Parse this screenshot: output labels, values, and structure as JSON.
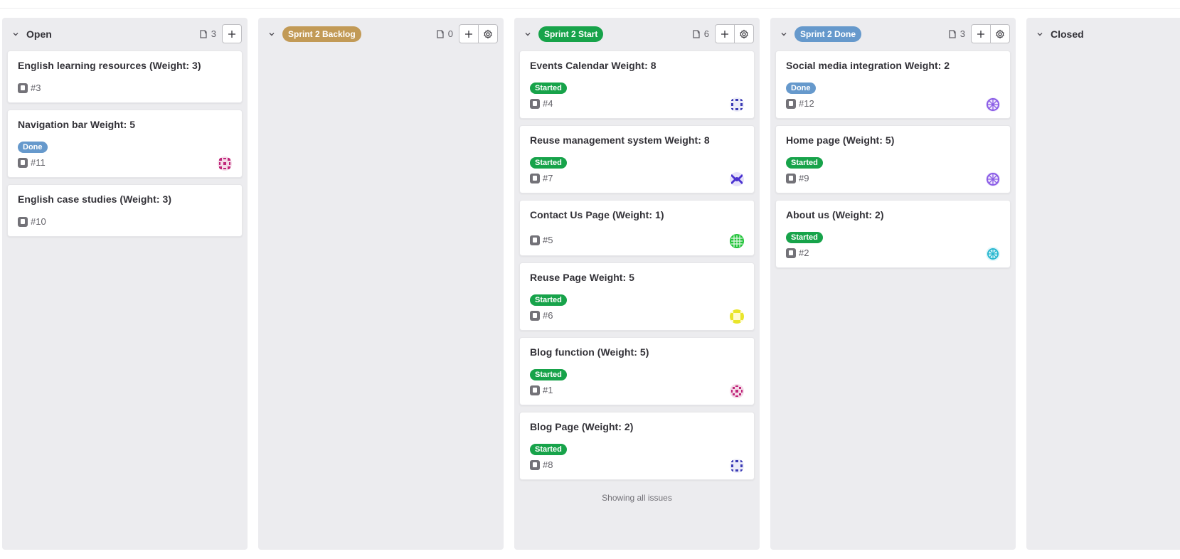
{
  "columns": [
    {
      "title": "Open",
      "count": "3",
      "label_color": "",
      "cards": [
        {
          "title": "English learning resources (Weight: 3)",
          "ref": "#3",
          "status": "",
          "avatar_color": ""
        },
        {
          "title": "Navigation bar Weight: 5",
          "ref": "#11",
          "status": "Done",
          "avatar_color": "#c0267a"
        },
        {
          "title": "English case studies (Weight: 3)",
          "ref": "#10",
          "status": "",
          "avatar_color": ""
        }
      ]
    },
    {
      "title": "Sprint 2 Backlog",
      "count": "0",
      "label_color": "#c29a56",
      "cards": []
    },
    {
      "title": "Sprint 2 Start",
      "count": "6",
      "label_color": "#17a34a",
      "cards": [
        {
          "title": "Events Calendar Weight: 8",
          "ref": "#4",
          "status": "Started",
          "avatar_color": "#3b3bb5"
        },
        {
          "title": "Reuse management system Weight: 8",
          "ref": "#7",
          "status": "Started",
          "avatar_color": "#4a32d0"
        },
        {
          "title": "Contact Us Page (Weight: 1)",
          "ref": "#5",
          "status": "",
          "avatar_color": "#22c33a"
        },
        {
          "title": "Reuse Page Weight: 5",
          "ref": "#6",
          "status": "Started",
          "avatar_color": "#e9e52a"
        },
        {
          "title": "Blog function (Weight: 5)",
          "ref": "#1",
          "status": "Started",
          "avatar_color": "#c0267a"
        },
        {
          "title": "Blog Page (Weight: 2)",
          "ref": "#8",
          "status": "Started",
          "avatar_color": "#3b3bb5"
        }
      ],
      "footer": "Showing all issues"
    },
    {
      "title": "Sprint 2 Done",
      "count": "3",
      "label_color": "#6699cc",
      "cards": [
        {
          "title": "Social media integration Weight: 2",
          "ref": "#12",
          "status": "Done",
          "avatar_color": "#8a5ce6"
        },
        {
          "title": "Home page (Weight: 5)",
          "ref": "#9",
          "status": "Started",
          "avatar_color": "#8a5ce6"
        },
        {
          "title": "About us (Weight: 2)",
          "ref": "#2",
          "status": "Started",
          "avatar_color": "#2bb8d0"
        }
      ]
    },
    {
      "title": "Closed",
      "count": "",
      "label_color": "",
      "cards": []
    }
  ],
  "colors": {
    "started": "#17a34a",
    "done": "#6699cc"
  }
}
